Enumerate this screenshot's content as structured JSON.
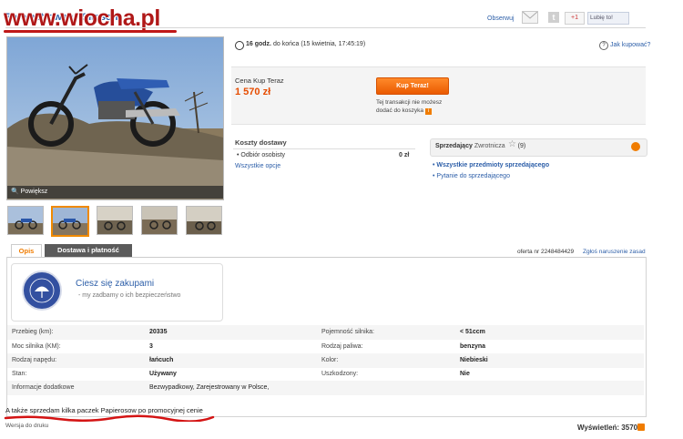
{
  "header": {
    "title": "Zarejestrowany Simson",
    "watermark": "www.wiocha.pl",
    "observe_label": "Obserwuj",
    "gplus_label": "+1",
    "fb_like_label": "Lubię to!"
  },
  "gallery": {
    "zoom_label": "Powiększ",
    "thumbnail_count": 5,
    "selected_thumbnail": 2
  },
  "timer": {
    "time_bold": "16 godz.",
    "time_rest": "do końca (15 kwietnia, 17:45:19)",
    "help_link": "Jak kupować?"
  },
  "price": {
    "label": "Cena Kup Teraz",
    "value": "1 570 zł",
    "buy_button": "Kup Teraz!",
    "note": "Tej transakcji nie możesz dodać do koszyka"
  },
  "shipping": {
    "title": "Koszty dostawy",
    "item_label": "Odbiór osobisty",
    "item_price": "0 zł",
    "all_options_link": "Wszystkie opcje"
  },
  "seller": {
    "label": "Sprzedający",
    "name": "Zwrotnicza",
    "rating": "(9)",
    "all_items_link": "Wszystkie przedmioty sprzedającego",
    "ask_link": "Pytanie do sprzedającego"
  },
  "tabs": {
    "description": "Opis",
    "shipping_payment": "Dostawa i płatność",
    "offer_number": "oferta nr 2248484429",
    "report_link": "Zgłoś naruszenie zasad"
  },
  "protection": {
    "badge_text": "PROGRAM OCHRONY KUPUJĄCYCH",
    "title": "Ciesz się zakupami",
    "subtitle": "my zadbamy o ich bezpieczeństwo"
  },
  "params": [
    {
      "label": "Przebieg (km):",
      "value": "20335",
      "label2": "Pojemność silnika:",
      "value2": "< 51ccm"
    },
    {
      "label": "Moc silnika (KM):",
      "value": "3",
      "label2": "Rodzaj paliwa:",
      "value2": "benzyna"
    },
    {
      "label": "Rodzaj napędu:",
      "value": "łańcuch",
      "label2": "Kolor:",
      "value2": "Niebieski"
    },
    {
      "label": "Stan:",
      "value": "Używany",
      "label2": "Uszkodzony:",
      "value2": "Nie"
    },
    {
      "label": "Informacje dodatkowe",
      "value": "Bezwypadkowy, Zarejestrowany w Polsce,",
      "label2": "",
      "value2": ""
    }
  ],
  "description_text": "A także sprzedam kilka paczek Papierosow po promocyjnej cenie",
  "footer": {
    "print_link": "Wersja do druku",
    "views": "Wyświetleń: 3570"
  },
  "colors": {
    "accent_orange": "#f07c00",
    "price_orange": "#e64c00",
    "link_blue": "#2c5ea8",
    "watermark_red": "#b01818"
  }
}
